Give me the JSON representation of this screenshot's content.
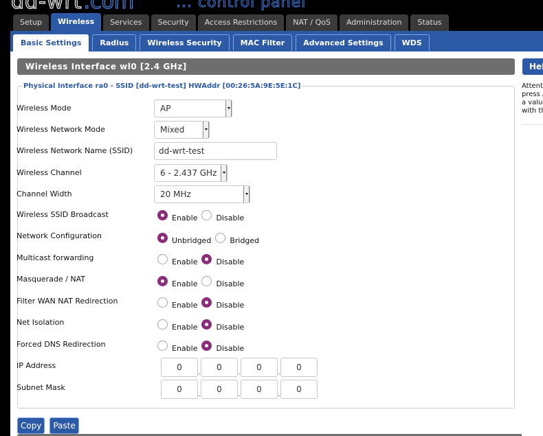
{
  "logo": {
    "brand": "dd-wrt",
    "dotcom": ".com",
    "tagline": "... control panel"
  },
  "main_tabs": [
    "Setup",
    "Wireless",
    "Services",
    "Security",
    "Access Restrictions",
    "NAT / QoS",
    "Administration",
    "Status"
  ],
  "sub_tabs": [
    "Basic Settings",
    "Radius",
    "Wireless Security",
    "MAC Filter",
    "Advanced Settings",
    "WDS"
  ],
  "section_title": "Wireless Interface wl0 [2.4 GHz]",
  "panel_legend": "Physical Interface ra0 - SSID [dd-wrt-test] HWAddr [00:26:5A:9E:5E:1C]",
  "fields": {
    "wireless_mode": {
      "label": "Wireless Mode",
      "value": "AP"
    },
    "network_mode": {
      "label": "Wireless Network Mode",
      "value": "Mixed"
    },
    "ssid": {
      "label": "Wireless Network Name (SSID)",
      "value": "dd-wrt-test"
    },
    "channel": {
      "label": "Wireless Channel",
      "value": "6 - 2.437 GHz"
    },
    "channel_width": {
      "label": "Channel Width",
      "value": "20 MHz"
    },
    "ssid_broadcast": {
      "label": "Wireless SSID Broadcast",
      "opt1": "Enable",
      "opt2": "Disable",
      "selected": "Enable"
    },
    "network_config": {
      "label": "Network Configuration",
      "opt1": "Unbridged",
      "opt2": "Bridged",
      "selected": "Unbridged"
    },
    "multicast": {
      "label": "Multicast forwarding",
      "opt1": "Enable",
      "opt2": "Disable",
      "selected": "Disable"
    },
    "masquerade": {
      "label": "Masquerade / NAT",
      "opt1": "Enable",
      "opt2": "Disable",
      "selected": "Enable"
    },
    "filter_wan": {
      "label": "Filter WAN NAT Redirection",
      "opt1": "Enable",
      "opt2": "Disable",
      "selected": "Disable"
    },
    "net_isolation": {
      "label": "Net Isolation",
      "opt1": "Enable",
      "opt2": "Disable",
      "selected": "Disable"
    },
    "forced_dns": {
      "label": "Forced DNS Redirection",
      "opt1": "Enable",
      "opt2": "Disable",
      "selected": "Disable"
    },
    "ip_address": {
      "label": "IP Address",
      "octets": [
        "0",
        "0",
        "0",
        "0"
      ]
    },
    "subnet_mask": {
      "label": "Subnet Mask",
      "octets": [
        "0",
        "0",
        "0",
        "0"
      ]
    }
  },
  "buttons": {
    "copy": "Copy",
    "paste": "Paste"
  },
  "help": {
    "title": "Hel",
    "lines": [
      "Attenti",
      "press A",
      "a value",
      "with th"
    ]
  },
  "colors": {
    "accent": "#2c5aa6",
    "radio_selected": "#8b2d7a",
    "section_header": "#6e6e6e"
  }
}
